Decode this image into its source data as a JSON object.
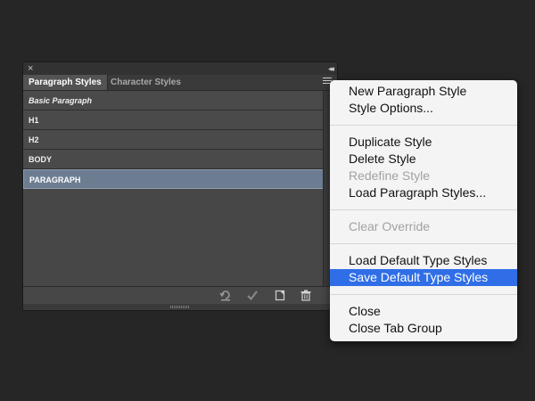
{
  "panel": {
    "close_glyph": "×",
    "collapse_glyph": "◂◂",
    "tabs": [
      {
        "label": "Paragraph Styles"
      },
      {
        "label": "Character Styles"
      }
    ],
    "styles": [
      {
        "label": "Basic Paragraph"
      },
      {
        "label": "H1"
      },
      {
        "label": "H2"
      },
      {
        "label": "BODY"
      },
      {
        "label": "PARAGRAPH"
      }
    ],
    "bottom_icons": [
      "reset-icon",
      "checkmark-icon",
      "new-style-icon",
      "trash-icon"
    ]
  },
  "menu": {
    "items": [
      {
        "label": "New Paragraph Style"
      },
      {
        "label": "Style Options..."
      },
      {
        "label": "Duplicate Style"
      },
      {
        "label": "Delete Style"
      },
      {
        "label": "Redefine Style"
      },
      {
        "label": "Load Paragraph Styles..."
      },
      {
        "label": "Clear Override"
      },
      {
        "label": "Load Default Type Styles"
      },
      {
        "label": "Save Default Type Styles"
      },
      {
        "label": "Close"
      },
      {
        "label": "Close Tab Group"
      }
    ]
  },
  "colors": {
    "background": "#262626",
    "selected_row": "#6d7d91",
    "menu_highlight": "#2f6ee6"
  }
}
